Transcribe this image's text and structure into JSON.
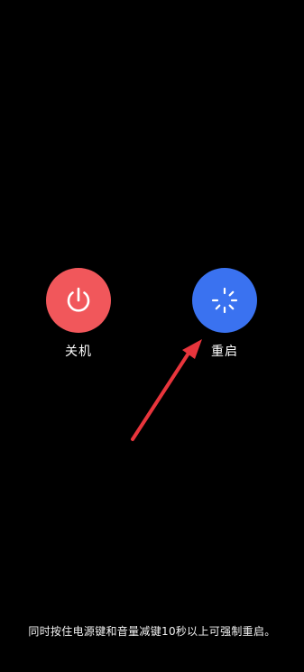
{
  "power_off": {
    "label": "关机",
    "icon": "power-icon",
    "color": "#f1575b"
  },
  "restart": {
    "label": "重启",
    "icon": "restart-spinner-icon",
    "color": "#3a72f0"
  },
  "annotation": {
    "icon": "red-arrow-icon",
    "color": "#e8353c"
  },
  "hint_text": "同时按住电源键和音量减键10秒以上可强制重启。"
}
